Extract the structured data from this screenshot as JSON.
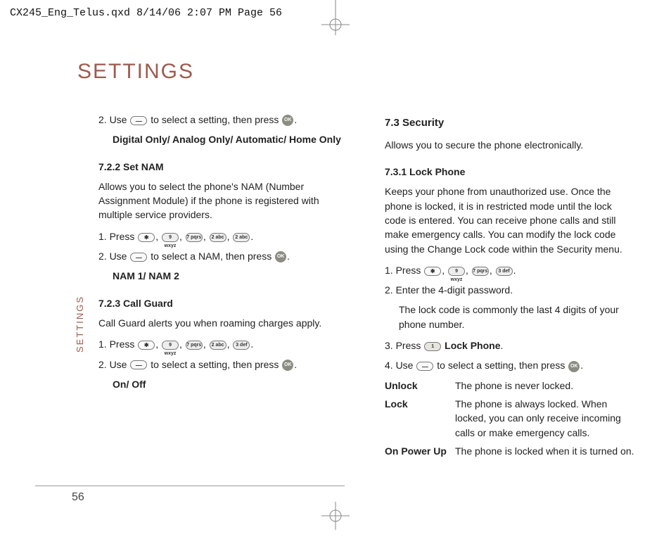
{
  "header": "CX245_Eng_Telus.qxd  8/14/06  2:07 PM  Page 56",
  "title": "SETTINGS",
  "sidetab": "SETTINGS",
  "page_number": "56",
  "left": {
    "step2_a": "2. Use ",
    "step2_b": " to select a setting, then press ",
    "step2_c": ".",
    "opt_digital": "Digital Only/ Analog Only/ Automatic/ Home Only",
    "h_722": "7.2.2 Set NAM",
    "p_722": "Allows you to select the phone's NAM (Number Assignment Module) if the phone is registered with multiple service providers.",
    "s722_1a": "1. Press ",
    "s722_1b": ", ",
    "s722_1c": ", ",
    "s722_1d": ", ",
    "s722_1e": ", ",
    "s722_1f": ".",
    "s722_2a": "2. Use ",
    "s722_2b": " to select a NAM, then press ",
    "s722_2c": ".",
    "opt_nam": "NAM 1/ NAM 2",
    "h_723": "7.2.3 Call Guard",
    "p_723": "Call Guard alerts you when roaming charges apply.",
    "s723_1a": "1. Press ",
    "s723_1b": ", ",
    "s723_1c": ", ",
    "s723_1d": ", ",
    "s723_1e": ", ",
    "s723_1f": ".",
    "s723_2a": "2. Use ",
    "s723_2b": " to select a setting, then press ",
    "s723_2c": ".",
    "opt_onoff": "On/ Off"
  },
  "right": {
    "h_73": "7.3 Security",
    "p_73": "Allows you to secure the phone electronically.",
    "h_731": "7.3.1 Lock Phone",
    "p_731": "Keeps your phone from unauthorized use. Once the phone is locked, it is in restricted mode until the lock code is entered. You can receive phone calls and still make emergency calls. You can modify the lock code using the Change Lock code within the Security menu.",
    "s731_1a": "1. Press ",
    "s731_1b": ", ",
    "s731_1c": ", ",
    "s731_1d": ", ",
    "s731_1e": ".",
    "s731_2": "2. Enter the 4-digit password.",
    "s731_2note": "The lock code is commonly the last 4 digits of your phone number.",
    "s731_3a": "3. Press ",
    "s731_3b": " Lock Phone",
    "s731_3c": ".",
    "s731_4a": "4. Use ",
    "s731_4b": " to select a setting, then press ",
    "s731_4c": ".",
    "dl": {
      "unlock_t": "Unlock",
      "unlock_d": "The phone is never locked.",
      "lock_t": "Lock",
      "lock_d": "The phone is always locked. When locked, you can only receive incoming calls or make emergency calls.",
      "power_t": "On Power Up",
      "power_d": "The phone is locked when it is turned on."
    }
  },
  "keys": {
    "k9": "9 wxyz",
    "k7": "7 pqrs",
    "k2": "2 abc",
    "k3": "3 def",
    "k1": "1",
    "ok": "OK"
  }
}
